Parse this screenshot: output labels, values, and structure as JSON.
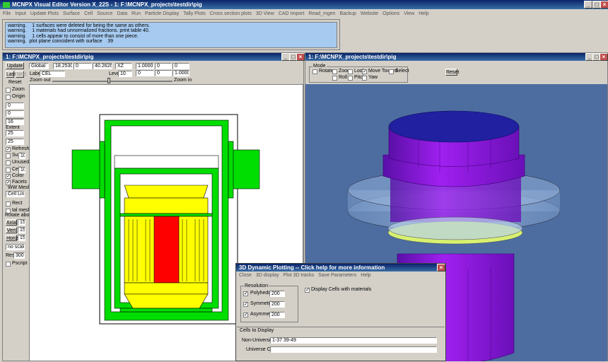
{
  "app": {
    "title": "MCNPX Visual Editor Version X_22S  - 1:  F:\\MCNPX_projects\\testdir\\pig",
    "menu": [
      "File",
      "Input",
      "Update Plots",
      "Surface",
      "Cell",
      "Source",
      "Data",
      "Run",
      "Particle Display",
      "Tally Plots",
      "Cross section plots",
      "3D View",
      "CAD Import",
      "Read_mgen",
      "Backup",
      "Website",
      "Options",
      "View",
      "Help"
    ]
  },
  "messages": [
    "warning.    1 surfaces were deleted for being the same as others.",
    "warning.    1 materials had unnormalized fractions. print table 40.",
    "warning.    1 cells appear to consist of more than one piece.",
    "warning.  plot plane coincident with surface    39"
  ],
  "plot2d": {
    "title": "1:  F:\\MCNPX_projects\\testdir\\pig",
    "update": "Update",
    "last": "Last",
    "next": "Next",
    "reset": "Reset",
    "zoom": "Zoom",
    "origin": "Origin",
    "origin_vals": [
      "0",
      "0",
      "0"
    ],
    "extent_vals": [
      "16",
      "25",
      "25"
    ],
    "extent_label": "Extent",
    "refresh": "Refresh",
    "surf": "Surf",
    "surf_val": "10",
    "unused": "Unused",
    "cell": "Cell",
    "cell_val": "10",
    "color": "Color",
    "facets": "Facets",
    "ww_mesh": "WW Mesh",
    "cell_lines": "Cell Line",
    "rect": "Rect",
    "tal_mesh": "tal mesh",
    "rotate_about": "Rotate about",
    "axial": "Axial",
    "vert": "Vert",
    "horiz": "Horiz",
    "rot_vals": [
      "15",
      "15",
      "15"
    ],
    "scale": "no scale",
    "res": "Res",
    "res_val": "300",
    "postscript": "Pscript",
    "coord_mode": "Global",
    "coords": [
      "18.2530",
      "0",
      "40.2626"
    ],
    "plane": "XZ",
    "plane_vals": [
      "1.0000",
      "0",
      "0"
    ],
    "label_txt": "Label",
    "label_val": "CEL",
    "level_txt": "Level",
    "level_val": "10",
    "level_vals": [
      "0",
      "0",
      "1.0000"
    ],
    "zoom_out": "Zoom out",
    "zoom_in": "Zoom in"
  },
  "view3d": {
    "title": "1:  F:\\MCNPX_projects\\testdir\\pig",
    "mode": "Mode",
    "rotate": "Rotate",
    "zoom": "Zoom",
    "look": "Look",
    "move_toward": "Move Toward",
    "select": "Select",
    "roll": "Roll",
    "pitch": "Pitch",
    "yaw": "Yaw",
    "reset": "Reset"
  },
  "dyn": {
    "title": "3D Dynamic Plotting -- Click help for more information",
    "menu": [
      "Close",
      "3D display",
      "Plot 3D tracks",
      "Save Parameters",
      "Help"
    ],
    "resolution": "Resolution",
    "polyhedra": "Polyhedra",
    "polyhedra_val": "200",
    "symmetric": "Symmetric",
    "symmetric_val": "200",
    "asymmetric": "Asymmetric",
    "asymmetric_val": "200",
    "display_cells": "Display Cells with materials",
    "cells_to_display": "Cells to Display",
    "non_universe": "Non-Universe cells:",
    "non_universe_val": "1-37  39-49",
    "universe": "Universe Cells:",
    "universe_val": ""
  },
  "colors": {
    "titlebar": "#0a246a",
    "msg_bg": "#a6caf0",
    "green": "#00dd00",
    "yellow": "#ffff00",
    "red": "#ff0000",
    "purple": "#9900ee",
    "view_bg": "#4d6da0"
  }
}
